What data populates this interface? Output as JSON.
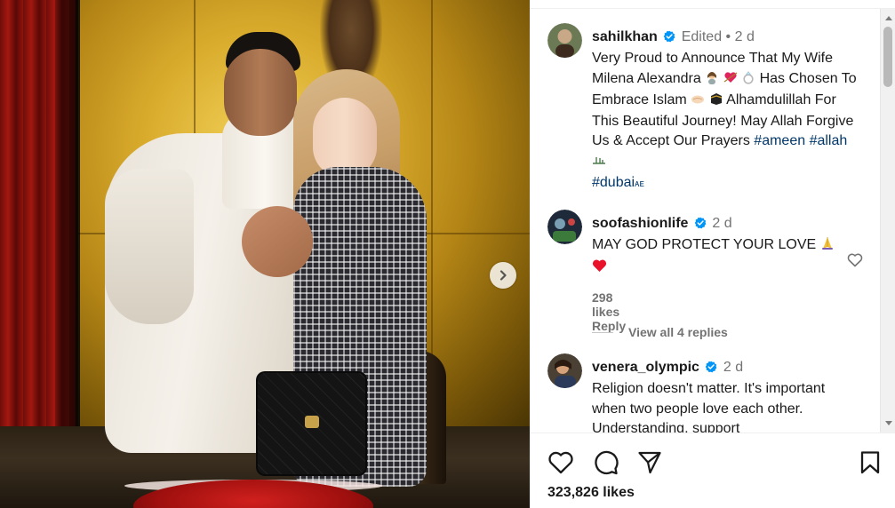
{
  "post": {
    "caption": {
      "username": "sahilkhan",
      "edited": "Edited",
      "separator": "•",
      "time": "2 d",
      "text_1": "Very Proud to Announce That My Wife Milena Alexandra",
      "text_2": "Has Chosen To Embrace Islam",
      "text_3": "Alhamdulillah For This Beautiful Journey! May Allah Forgive Us & Accept Our Prayers",
      "hashtags": [
        "#ameen",
        "#allah",
        "#dubai"
      ],
      "suffix_emoji": "ᴀᴇ"
    },
    "comments": [
      {
        "username": "soofashionlife",
        "time": "2 d",
        "text": "MAY GOD PROTECT YOUR LOVE",
        "likes": "298 likes",
        "reply": "Reply",
        "view_replies": "View all 4 replies"
      },
      {
        "username": "venera_olympic",
        "time": "2 d",
        "text": "Religion doesn't matter. It's important when two people love each other. Understanding, support"
      }
    ],
    "likes_count": "323,826 likes"
  },
  "icons": {
    "verified": "verified-badge-icon",
    "next": "chevron-right-icon",
    "like": "heart-icon",
    "comment": "comment-bubble-icon",
    "share": "paper-plane-icon",
    "save": "bookmark-icon"
  },
  "colors": {
    "verified": "#0095f6",
    "hashtag": "#00376b",
    "meta": "#737373"
  }
}
